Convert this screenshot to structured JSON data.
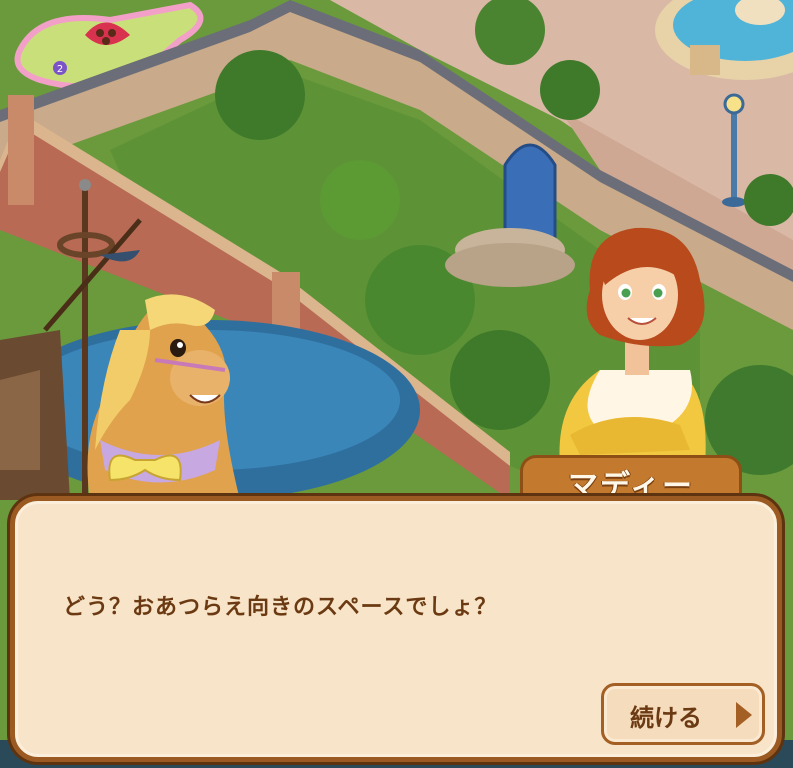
{
  "dialog": {
    "speaker": "マディー",
    "text": "どう？おあつらえ向きのスペースでしょ？",
    "continue_label": "続ける"
  },
  "scene": {
    "badge_number": "2",
    "icons": [
      "chocolate-box-icon",
      "fountain-icon",
      "blue-gate-icon",
      "lamp-post-icon",
      "horse-character",
      "maddie-character",
      "ship-icon"
    ]
  }
}
